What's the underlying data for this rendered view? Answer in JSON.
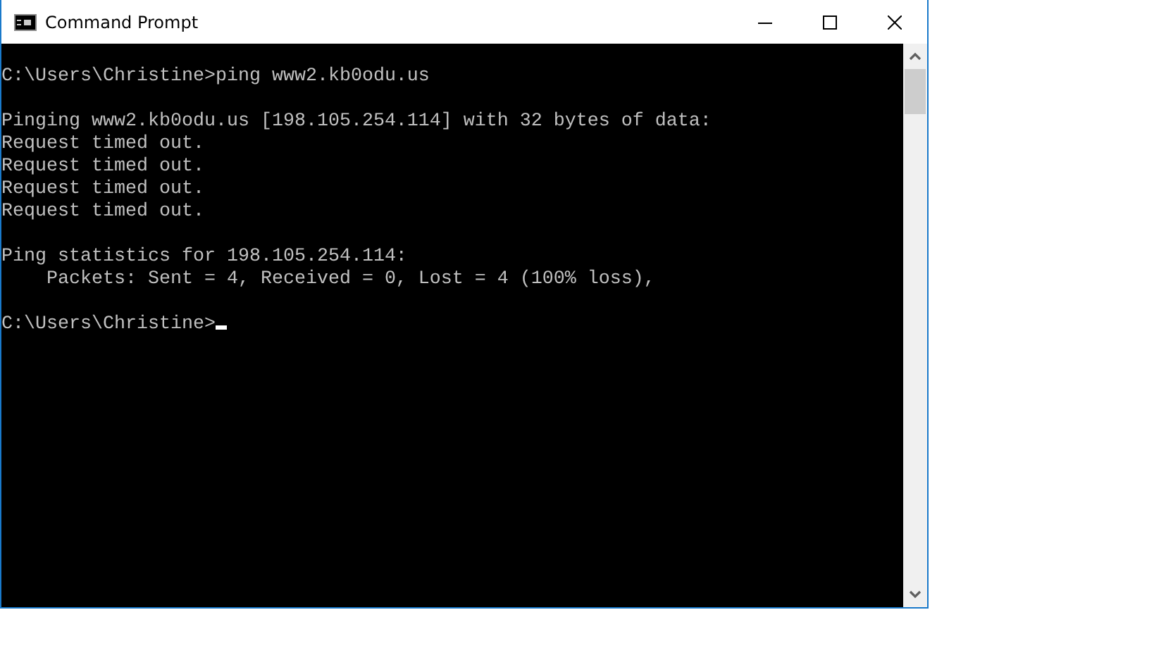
{
  "window": {
    "title": "Command Prompt"
  },
  "console": {
    "blocks": [
      [
        "C:\\Users\\Christine>ping www2.kb0odu.us"
      ],
      [
        "Pinging www2.kb0odu.us [198.105.254.114] with 32 bytes of data:",
        "Request timed out.",
        "Request timed out.",
        "Request timed out.",
        "Request timed out."
      ],
      [
        "Ping statistics for 198.105.254.114:",
        "    Packets: Sent = 4, Received = 0, Lost = 4 (100% loss),"
      ],
      [
        "C:\\Users\\Christine>"
      ]
    ],
    "cursor_visible": true
  }
}
